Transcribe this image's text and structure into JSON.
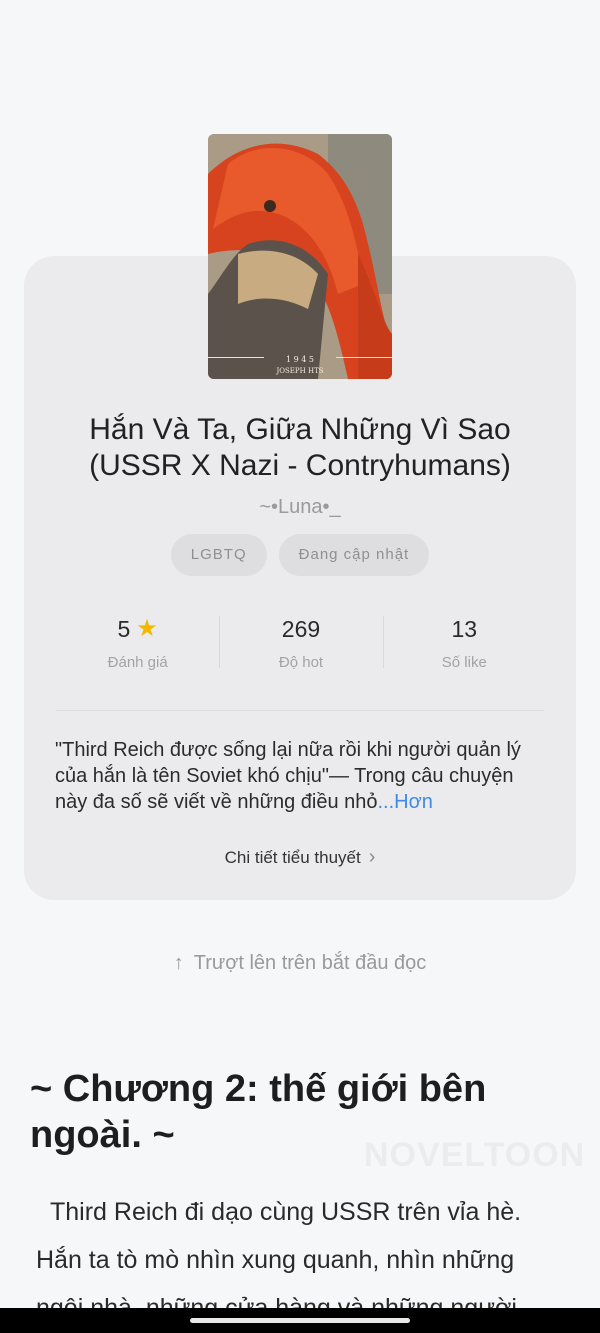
{
  "novel": {
    "title": "Hắn Và Ta, Giữa Những Vì Sao (USSR X Nazi - Contryhumans)",
    "author": "~•Luna•_",
    "cover": {
      "year_text": "1 9 4 5",
      "signature_text": "JOSEPH HTS"
    },
    "tags": [
      "LGBTQ",
      "Đang cập nhật"
    ],
    "stats": [
      {
        "value": "5",
        "label": "Đánh giá",
        "icon": "star-icon"
      },
      {
        "value": "269",
        "label": "Độ hot"
      },
      {
        "value": "13",
        "label": "Số like"
      }
    ],
    "description": "\"Third Reich được sống lại nữa rồi khi người quản lý của hắn là tên Soviet khó chịu\"— Trong câu chuyện này đa số sẽ viết về những điều nhỏ",
    "more_label": "...Hơn",
    "details_label": "Chi tiết tiểu thuyết"
  },
  "swipe_hint": "Trượt lên trên bắt đầu đọc",
  "chapter": {
    "title": "~ Chương 2: thế giới bên ngoài. ~",
    "watermark": "NOVELTOON",
    "text": "Third Reich đi dạo cùng USSR trên vỉa hè. Hắn ta tò mò nhìn xung quanh, nhìn những ngôi nhà, những cửa hàng và những người"
  },
  "colors": {
    "accent_link": "#3e8ae6",
    "star": "#f5b800",
    "card_bg": "#ebebed"
  }
}
